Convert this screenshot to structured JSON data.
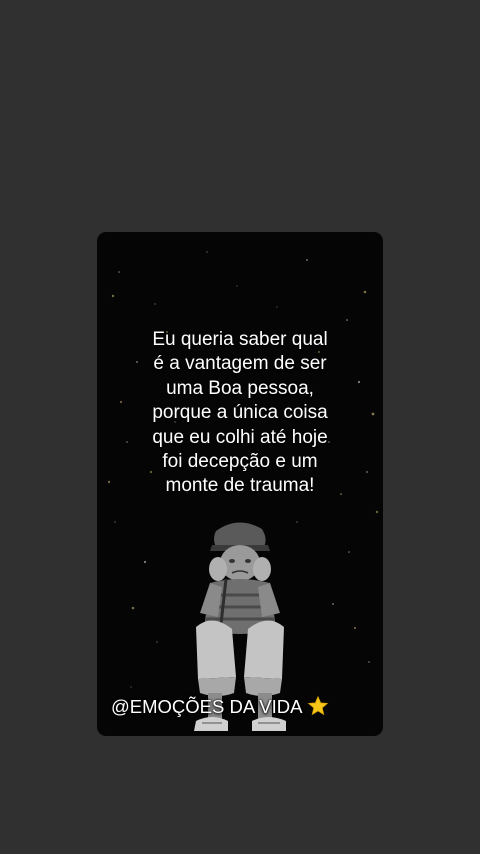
{
  "post": {
    "quote_lines": [
      "Eu queria saber qual",
      "é a vantagem de ser",
      "uma Boa pessoa,",
      "porque a única coisa",
      "que eu colhi até hoje",
      "foi decepção e um",
      "monte de trauma!"
    ],
    "handle": "@EMOÇÕES DA VIDA",
    "handle_icon": "star-emoji-icon",
    "figure_icon": "sad-sitting-boy-illustration"
  },
  "colors": {
    "page_background": "#303030",
    "card_background": "#050505",
    "text": "#ffffff",
    "star": "#f5c518"
  }
}
